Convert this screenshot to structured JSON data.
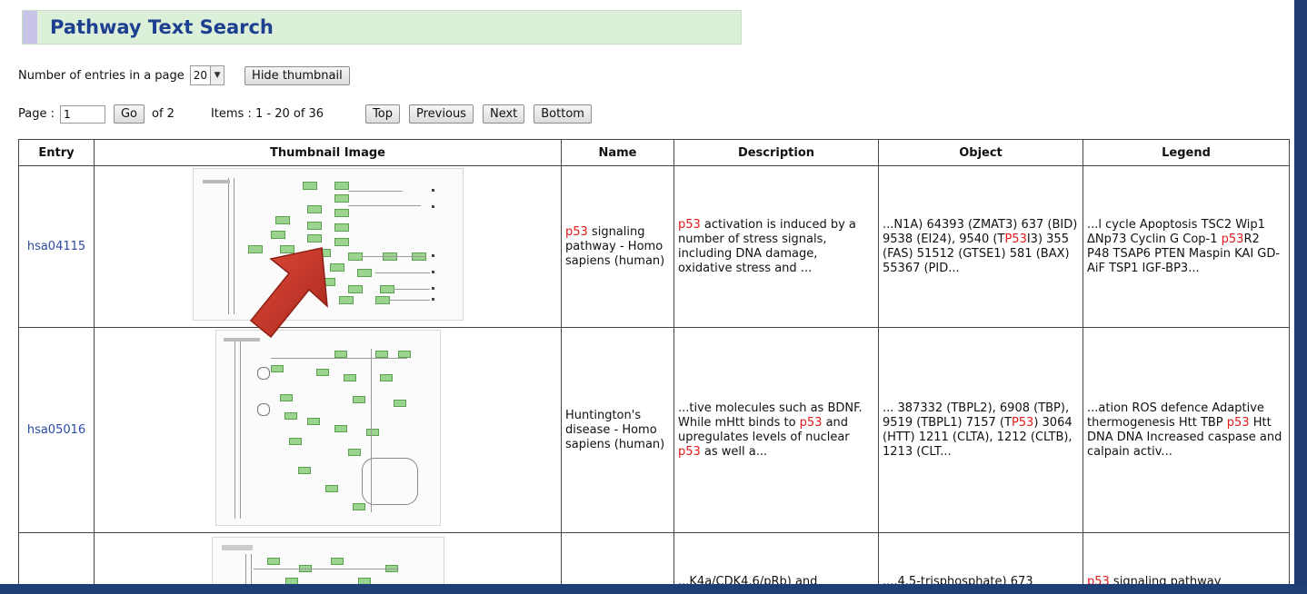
{
  "title": "Pathway Text Search",
  "controls": {
    "entries_label": "Number of entries in a page",
    "entries_value": "20",
    "hide_thumbnail_label": "Hide thumbnail",
    "page_label": "Page :",
    "page_value": "1",
    "go_label": "Go",
    "of_label": "of 2",
    "items_label": "Items : 1 - 20 of 36",
    "top_label": "Top",
    "previous_label": "Previous",
    "next_label": "Next",
    "bottom_label": "Bottom"
  },
  "table": {
    "headers": [
      "Entry",
      "Thumbnail Image",
      "Name",
      "Description",
      "Object",
      "Legend"
    ],
    "rows": [
      {
        "entry": "hsa04115",
        "name": [
          "p53",
          " signaling pathway - Homo sapiens (human)"
        ],
        "description": [
          "p53",
          " activation is induced by a number of stress signals, including DNA damage, oxidative stress and ..."
        ],
        "object": [
          "...N1A) 64393 (ZMAT3) 637 (BID) 9538 (EI24), 9540 (T",
          "P53",
          "I3) 355 (FAS) 51512 (GTSE1) 581 (BAX) 55367 (PID..."
        ],
        "legend": [
          "...l cycle Apoptosis TSC2 Wip1 ΔNp73 Cyclin G Cop-1 ",
          "p53",
          "R2 P48 TSAP6 PTEN Maspin KAI GD-AiF TSP1 IGF-BP3..."
        ]
      },
      {
        "entry": "hsa05016",
        "name": [
          "Huntington's disease - Homo sapiens (human)"
        ],
        "description": [
          "...tive molecules such as BDNF. While mHtt binds to ",
          "p53",
          " and upregulates levels of nuclear ",
          "p53",
          " as well a..."
        ],
        "object": [
          "... 387332 (TBPL2), 6908 (TBP), 9519 (TBPL1) 7157 (T",
          "P53",
          ") 3064 (HTT) 1211 (CLTA), 1212 (CLTB), 1213 (CLT..."
        ],
        "legend": [
          "...ation ROS defence Adaptive thermogenesis Htt TBP ",
          "p53",
          " Htt DNA DNA Increased caspase and calpain activ..."
        ]
      },
      {
        "entry": "",
        "name": [
          ""
        ],
        "description": [
          "...K4a/CDK4,6/pRb) and"
        ],
        "object": [
          "...,4,5-trisphosphate) 673"
        ],
        "legend": [
          "p53",
          " signaling pathway"
        ]
      }
    ]
  },
  "colors": {
    "title_bg": "#dcefd9",
    "title_text": "#1d3f8f",
    "link": "#2a4aa5",
    "highlight": "#e01a1a",
    "arrow": "#c0392b",
    "frame": "#1e3c72"
  },
  "icons": {
    "dropdown": "chevron-down-icon",
    "pointer": "red-arrow-pointer"
  }
}
